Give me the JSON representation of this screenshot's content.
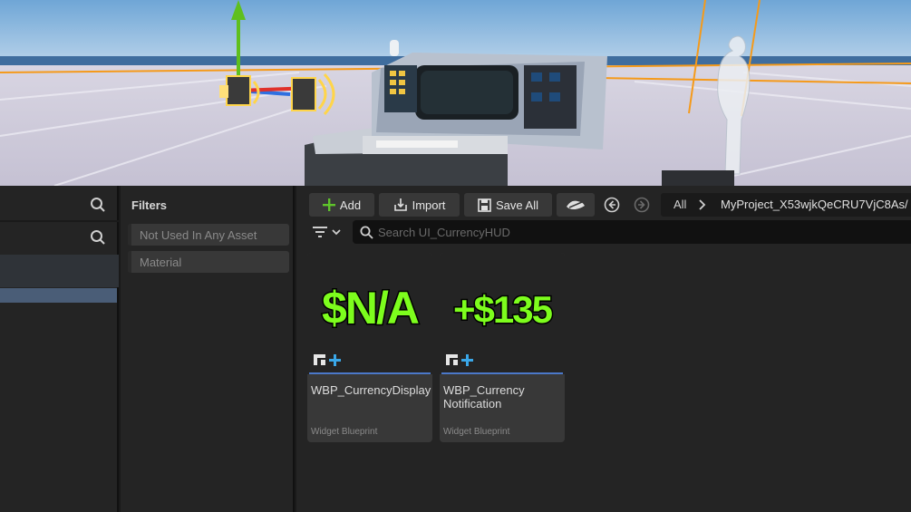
{
  "viewport": {
    "scene": "level-editor-viewport"
  },
  "tree_panel": {
    "search_icon": "search-icon"
  },
  "filters": {
    "title": "Filters",
    "chips": [
      "Not Used In Any Asset",
      "Material"
    ]
  },
  "toolbar": {
    "add_label": "Add",
    "import_label": "Import",
    "save_all_label": "Save All"
  },
  "path": {
    "root": "All",
    "project": "MyProject_X53wjkQeCRU7VjC8As/"
  },
  "search": {
    "placeholder": "Search UI_CurrencyHUD"
  },
  "assets": [
    {
      "thumb_text": "$N/A",
      "name": "WBP_CurrencyDisplay",
      "type": "Widget Blueprint"
    },
    {
      "thumb_text": "+$135",
      "name": "WBP_Currency Notification",
      "type": "Widget Blueprint"
    }
  ],
  "colors": {
    "accent": "#4b78c9",
    "thumb_green": "#7dfd1d",
    "selection": "#4a5d77"
  }
}
